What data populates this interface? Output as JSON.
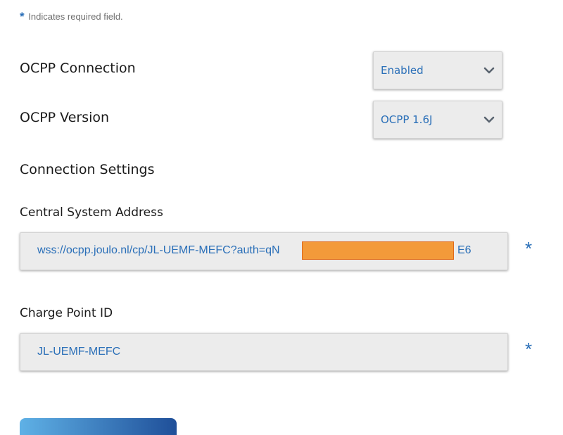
{
  "required_note": {
    "symbol": "*",
    "text": "Indicates required field."
  },
  "ocpp_connection": {
    "label": "OCPP Connection",
    "selected": "Enabled"
  },
  "ocpp_version": {
    "label": "OCPP Version",
    "selected": "OCPP 1.6J"
  },
  "connection_settings": {
    "title": "Connection Settings"
  },
  "central_system_address": {
    "label": "Central System Address",
    "value_visible_start": "wss://ocpp.joulo.nl/cp/JL-UEMF-MEFC?auth=qN",
    "value_visible_end": "E6",
    "required_symbol": "*"
  },
  "charge_point_id": {
    "label": "Charge Point ID",
    "value": "JL-UEMF-MEFC",
    "required_symbol": "*"
  },
  "colors": {
    "accent": "#2a6fb8",
    "field_bg": "#ececec",
    "redaction": "#f39a3a",
    "button_gradient_start": "#5fb1e6",
    "button_gradient_end": "#1f4f99"
  },
  "icons": {
    "dropdown": "chevron-down-icon"
  }
}
